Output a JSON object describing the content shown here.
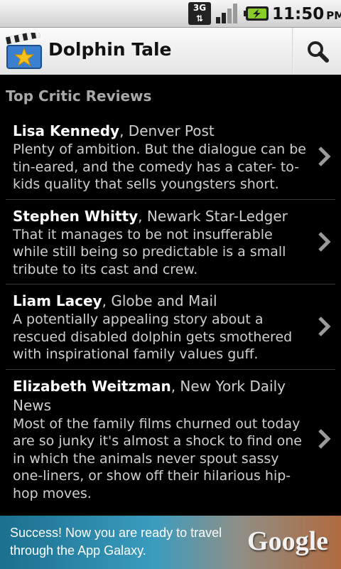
{
  "status_bar": {
    "network": "3G",
    "time": "11:50",
    "ampm": "PM"
  },
  "app": {
    "title": "Dolphin Tale",
    "icon": "clapperboard-star-icon",
    "search_icon": "search-icon"
  },
  "section": {
    "title": "Top Critic Reviews"
  },
  "reviews": [
    {
      "critic": "Lisa Kennedy",
      "outlet": ", Denver Post",
      "quote": "Plenty of ambition. But the dialogue can be tin-eared, and the comedy has a cater- to-kids quality that sells youngsters short."
    },
    {
      "critic": "Stephen Whitty",
      "outlet": ", Newark Star-Ledger",
      "quote": "That it manages to be not insufferable while still being so predictable is a small tribute to its cast and crew."
    },
    {
      "critic": "Liam Lacey",
      "outlet": ", Globe and Mail",
      "quote": "A potentially appealing story about a rescued disabled dolphin gets smothered with inspirational family values guff."
    },
    {
      "critic": "Elizabeth Weitzman",
      "outlet": ", New York Daily News",
      "quote": "Most of the family films churned out today are so junky it's almost a shock to find one in which the animals never spout sassy one-liners, or show off their hilarious hip-hop moves."
    }
  ],
  "ad": {
    "text": "Success! Now you are ready to travel through the App Galaxy.",
    "logo": "Google"
  },
  "colors": {
    "background": "#000000",
    "section_title": "#a9a9a9",
    "titlebar": "#f0f0f0"
  }
}
